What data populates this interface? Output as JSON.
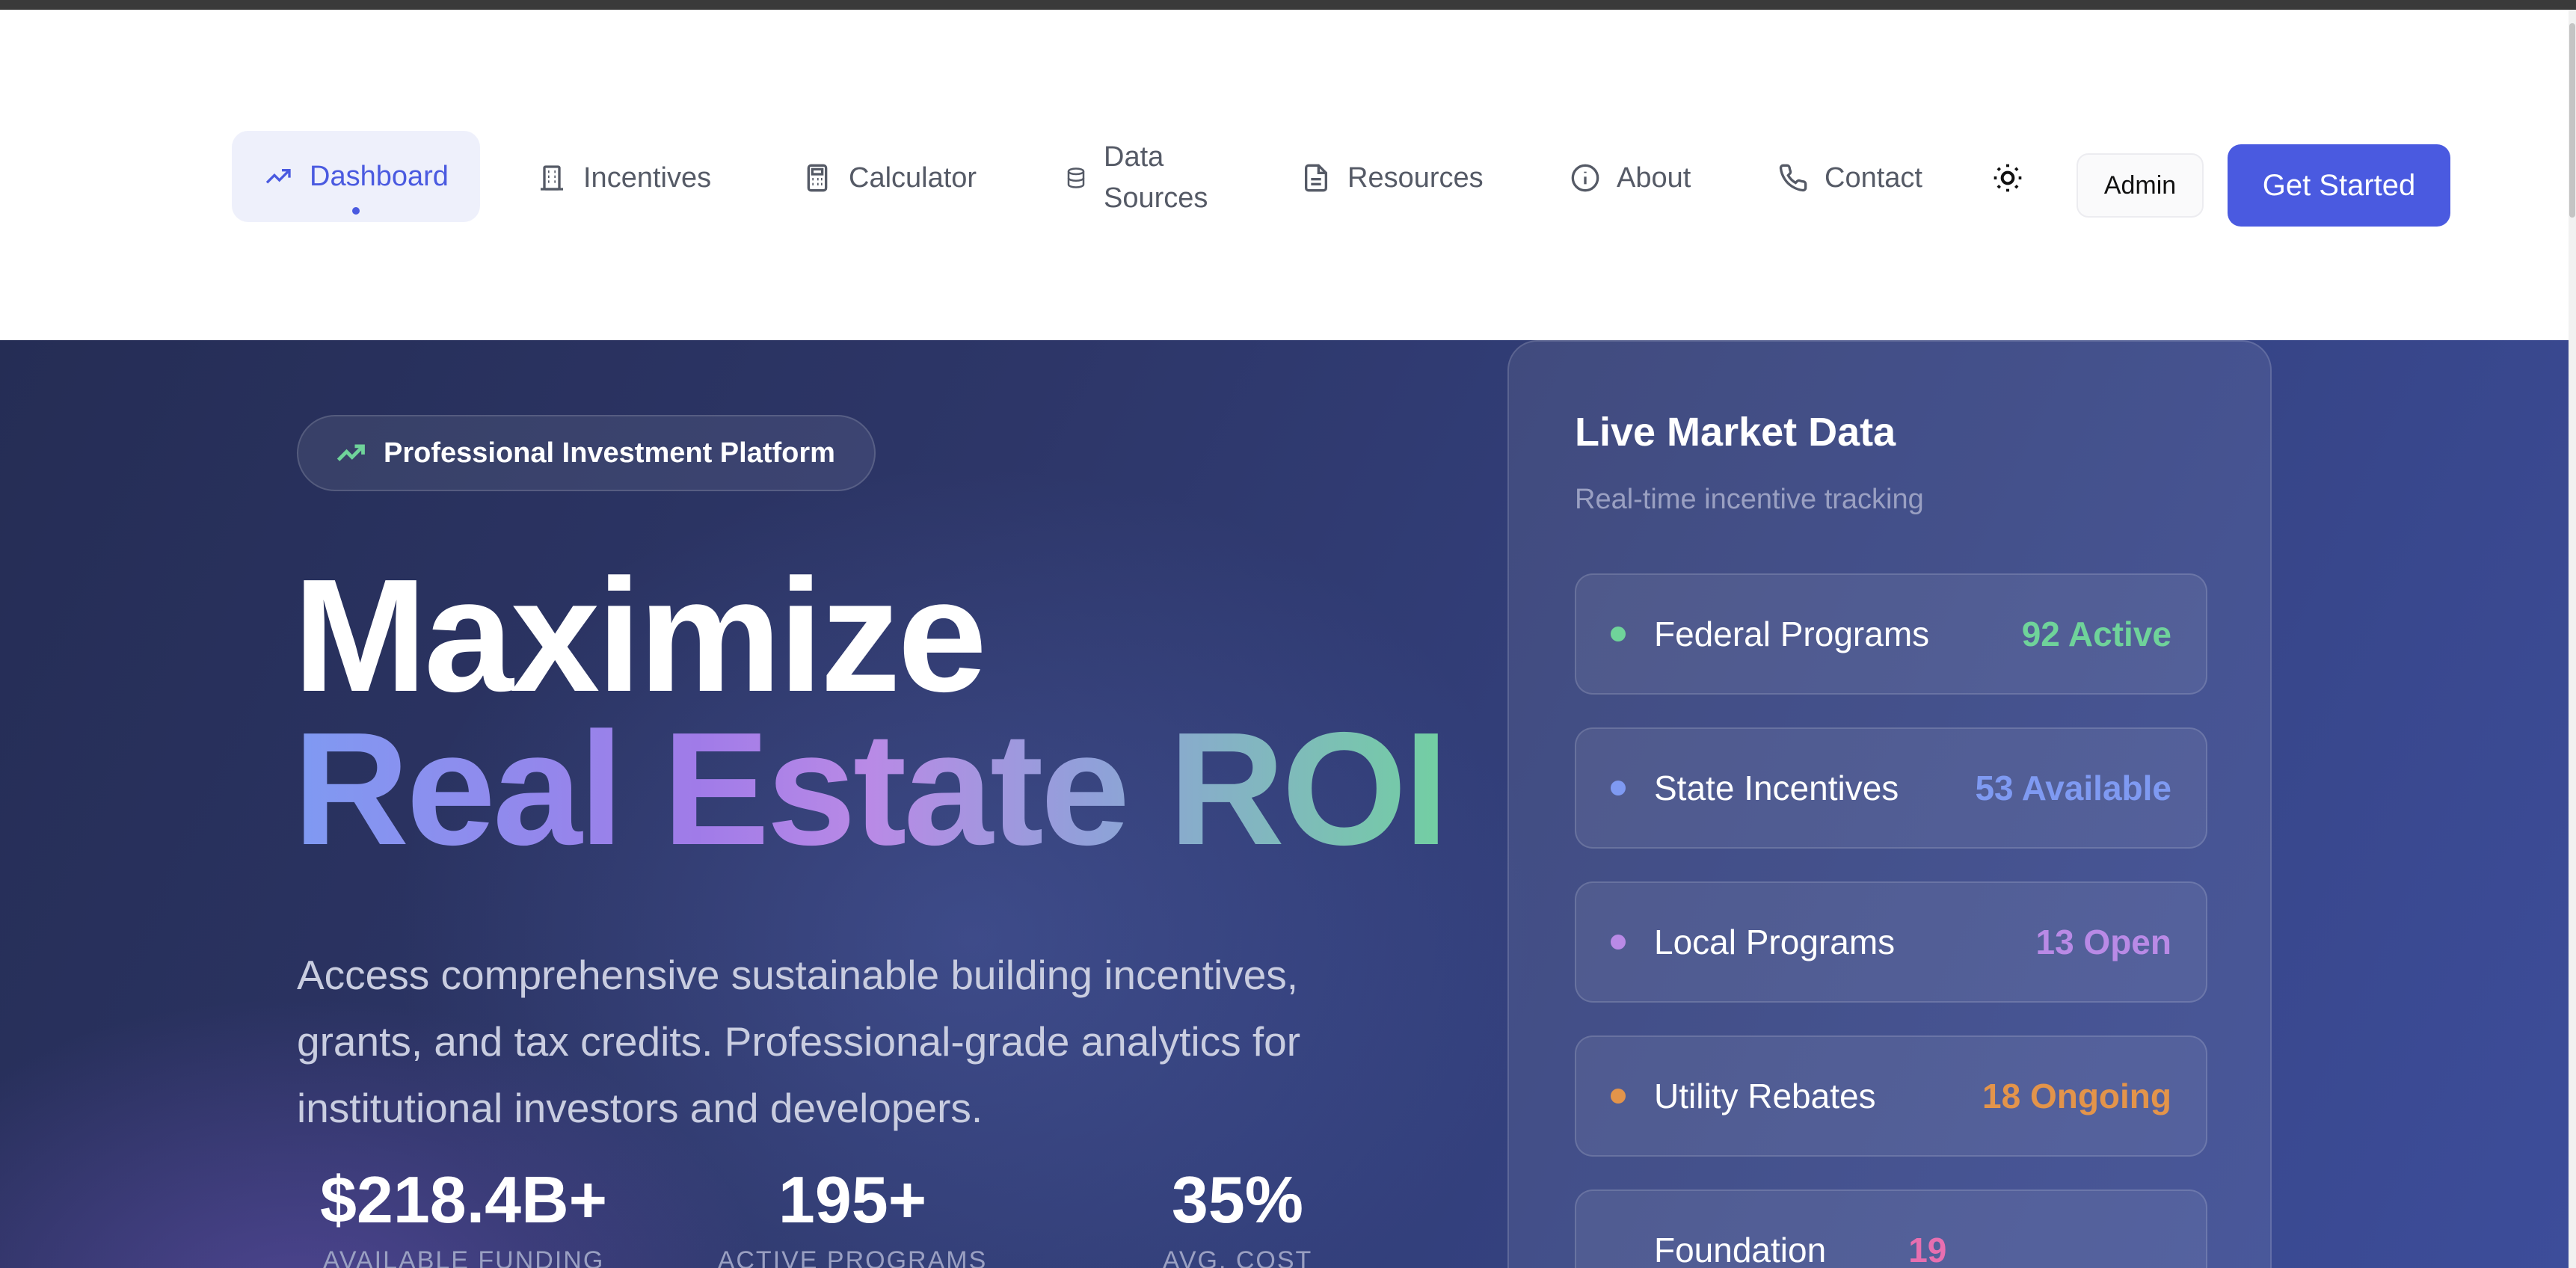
{
  "nav": {
    "items": [
      {
        "label": "Dashboard",
        "icon": "trending-up-icon",
        "active": true
      },
      {
        "label": "Incentives",
        "icon": "building-icon"
      },
      {
        "label": "Calculator",
        "icon": "calculator-icon"
      },
      {
        "label_line1": "Data",
        "label_line2": "Sources",
        "icon": "database-icon"
      },
      {
        "label": "Resources",
        "icon": "document-icon"
      },
      {
        "label": "About",
        "icon": "info-icon"
      },
      {
        "label": "Contact",
        "icon": "phone-icon"
      }
    ],
    "theme_toggle_icon": "sun-icon",
    "admin_label": "Admin",
    "cta_label": "Get Started"
  },
  "hero": {
    "badge": "Professional Investment Platform",
    "headline_line1": "Maximize",
    "headline_line2": "Real Estate ROI",
    "description": "Access comprehensive sustainable building incentives, grants, and tax credits. Professional-grade analytics for institutional investors and developers.",
    "stats": [
      {
        "value": "$218.4B+",
        "label": "AVAILABLE FUNDING"
      },
      {
        "value": "195+",
        "label": "ACTIVE PROGRAMS"
      },
      {
        "value": "35%",
        "label": "AVG. COST"
      }
    ]
  },
  "market": {
    "title": "Live Market Data",
    "subtitle": "Real-time incentive tracking",
    "rows": [
      {
        "name": "Federal Programs",
        "value": "92 Active",
        "color": "#6fd39a"
      },
      {
        "name": "State Incentives",
        "value": "53 Available",
        "color": "#7f9af2"
      },
      {
        "name": "Local Programs",
        "value": "13 Open",
        "color": "#b98ae6"
      },
      {
        "name": "Utility Rebates",
        "value": "18 Ongoing",
        "color": "#e3944a"
      },
      {
        "name": "Foundation",
        "value": "19",
        "color": "#e86fb0"
      }
    ]
  },
  "colors": {
    "accent": "#4a5ae0",
    "hero_bg": "#2d3668"
  }
}
